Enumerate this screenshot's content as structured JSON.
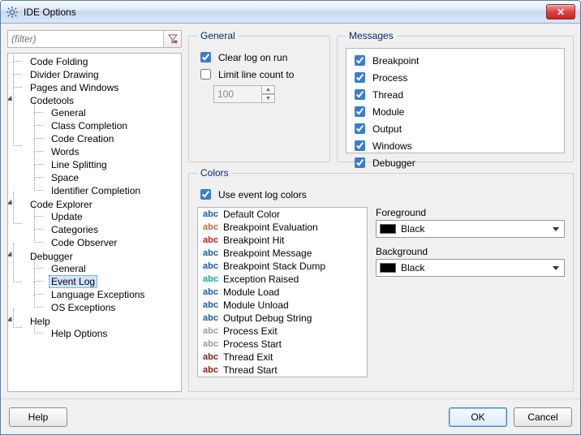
{
  "window": {
    "title": "IDE Options",
    "icon_name": "gear-icon"
  },
  "filter": {
    "placeholder": "(filter)"
  },
  "tree": {
    "code_folding": "Code Folding",
    "divider_drawing": "Divider Drawing",
    "pages_and_windows": "Pages and Windows",
    "codetools": "Codetools",
    "ct_general": "General",
    "ct_class": "Class Completion",
    "ct_codecreation": "Code Creation",
    "ct_words": "Words",
    "ct_linesplit": "Line Splitting",
    "ct_space": "Space",
    "ct_ident": "Identifier Completion",
    "code_explorer": "Code Explorer",
    "ce_update": "Update",
    "ce_categories": "Categories",
    "ce_observer": "Code Observer",
    "debugger": "Debugger",
    "dbg_general": "General",
    "dbg_eventlog": "Event Log",
    "dbg_lang": "Language Exceptions",
    "dbg_os": "OS Exceptions",
    "help": "Help",
    "help_options": "Help Options"
  },
  "general": {
    "legend": "General",
    "clear_log": "Clear log on run",
    "clear_log_checked": true,
    "limit_lines": "Limit line count to",
    "limit_lines_checked": false,
    "limit_value": "100"
  },
  "messages": {
    "legend": "Messages",
    "items": [
      {
        "label": "Breakpoint",
        "checked": true
      },
      {
        "label": "Process",
        "checked": true
      },
      {
        "label": "Thread",
        "checked": true
      },
      {
        "label": "Module",
        "checked": true
      },
      {
        "label": "Output",
        "checked": true
      },
      {
        "label": "Windows",
        "checked": true
      },
      {
        "label": "Debugger",
        "checked": true
      }
    ]
  },
  "colors": {
    "legend": "Colors",
    "use_event_log_colors": "Use event log colors",
    "use_event_log_colors_checked": true,
    "foreground_label": "Foreground",
    "background_label": "Background",
    "foreground_value": "Black",
    "background_value": "Black",
    "items": [
      {
        "label": "Default Color",
        "abc_color": "#1a59a6"
      },
      {
        "label": "Breakpoint Evaluation",
        "abc_color": "#c46a3b"
      },
      {
        "label": "Breakpoint Hit",
        "abc_color": "#c22020"
      },
      {
        "label": "Breakpoint Message",
        "abc_color": "#1a59a6"
      },
      {
        "label": "Breakpoint Stack Dump",
        "abc_color": "#1a59a6"
      },
      {
        "label": "Exception Raised",
        "abc_color": "#1ba39c"
      },
      {
        "label": "Module Load",
        "abc_color": "#1a59a6"
      },
      {
        "label": "Module Unload",
        "abc_color": "#1a59a6"
      },
      {
        "label": "Output Debug String",
        "abc_color": "#1a59a6"
      },
      {
        "label": "Process Exit",
        "abc_color": "#9a9a9a"
      },
      {
        "label": "Process Start",
        "abc_color": "#9a9a9a"
      },
      {
        "label": "Thread Exit",
        "abc_color": "#8a1a1a"
      },
      {
        "label": "Thread Start",
        "abc_color": "#8a1a1a"
      }
    ]
  },
  "buttons": {
    "help": "Help",
    "ok": "OK",
    "cancel": "Cancel"
  }
}
